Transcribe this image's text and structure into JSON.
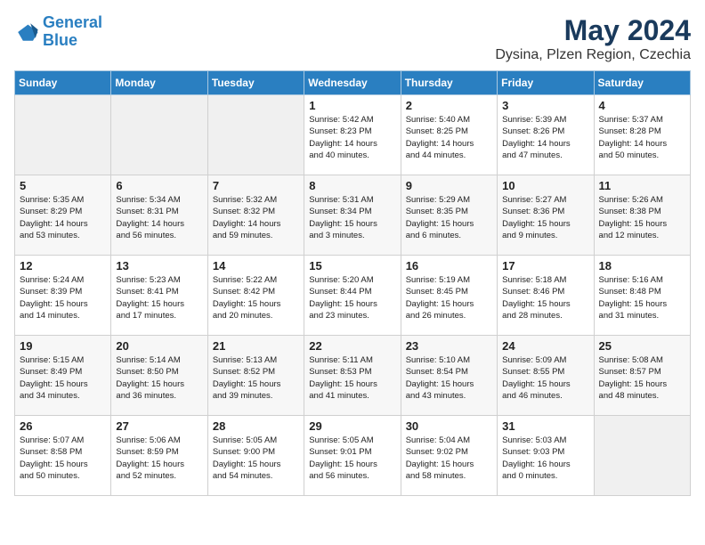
{
  "header": {
    "logo_line1": "General",
    "logo_line2": "Blue",
    "title": "May 2024",
    "subtitle": "Dysina, Plzen Region, Czechia"
  },
  "days_of_week": [
    "Sunday",
    "Monday",
    "Tuesday",
    "Wednesday",
    "Thursday",
    "Friday",
    "Saturday"
  ],
  "weeks": [
    [
      {
        "day": "",
        "info": ""
      },
      {
        "day": "",
        "info": ""
      },
      {
        "day": "",
        "info": ""
      },
      {
        "day": "1",
        "info": "Sunrise: 5:42 AM\nSunset: 8:23 PM\nDaylight: 14 hours\nand 40 minutes."
      },
      {
        "day": "2",
        "info": "Sunrise: 5:40 AM\nSunset: 8:25 PM\nDaylight: 14 hours\nand 44 minutes."
      },
      {
        "day": "3",
        "info": "Sunrise: 5:39 AM\nSunset: 8:26 PM\nDaylight: 14 hours\nand 47 minutes."
      },
      {
        "day": "4",
        "info": "Sunrise: 5:37 AM\nSunset: 8:28 PM\nDaylight: 14 hours\nand 50 minutes."
      }
    ],
    [
      {
        "day": "5",
        "info": "Sunrise: 5:35 AM\nSunset: 8:29 PM\nDaylight: 14 hours\nand 53 minutes."
      },
      {
        "day": "6",
        "info": "Sunrise: 5:34 AM\nSunset: 8:31 PM\nDaylight: 14 hours\nand 56 minutes."
      },
      {
        "day": "7",
        "info": "Sunrise: 5:32 AM\nSunset: 8:32 PM\nDaylight: 14 hours\nand 59 minutes."
      },
      {
        "day": "8",
        "info": "Sunrise: 5:31 AM\nSunset: 8:34 PM\nDaylight: 15 hours\nand 3 minutes."
      },
      {
        "day": "9",
        "info": "Sunrise: 5:29 AM\nSunset: 8:35 PM\nDaylight: 15 hours\nand 6 minutes."
      },
      {
        "day": "10",
        "info": "Sunrise: 5:27 AM\nSunset: 8:36 PM\nDaylight: 15 hours\nand 9 minutes."
      },
      {
        "day": "11",
        "info": "Sunrise: 5:26 AM\nSunset: 8:38 PM\nDaylight: 15 hours\nand 12 minutes."
      }
    ],
    [
      {
        "day": "12",
        "info": "Sunrise: 5:24 AM\nSunset: 8:39 PM\nDaylight: 15 hours\nand 14 minutes."
      },
      {
        "day": "13",
        "info": "Sunrise: 5:23 AM\nSunset: 8:41 PM\nDaylight: 15 hours\nand 17 minutes."
      },
      {
        "day": "14",
        "info": "Sunrise: 5:22 AM\nSunset: 8:42 PM\nDaylight: 15 hours\nand 20 minutes."
      },
      {
        "day": "15",
        "info": "Sunrise: 5:20 AM\nSunset: 8:44 PM\nDaylight: 15 hours\nand 23 minutes."
      },
      {
        "day": "16",
        "info": "Sunrise: 5:19 AM\nSunset: 8:45 PM\nDaylight: 15 hours\nand 26 minutes."
      },
      {
        "day": "17",
        "info": "Sunrise: 5:18 AM\nSunset: 8:46 PM\nDaylight: 15 hours\nand 28 minutes."
      },
      {
        "day": "18",
        "info": "Sunrise: 5:16 AM\nSunset: 8:48 PM\nDaylight: 15 hours\nand 31 minutes."
      }
    ],
    [
      {
        "day": "19",
        "info": "Sunrise: 5:15 AM\nSunset: 8:49 PM\nDaylight: 15 hours\nand 34 minutes."
      },
      {
        "day": "20",
        "info": "Sunrise: 5:14 AM\nSunset: 8:50 PM\nDaylight: 15 hours\nand 36 minutes."
      },
      {
        "day": "21",
        "info": "Sunrise: 5:13 AM\nSunset: 8:52 PM\nDaylight: 15 hours\nand 39 minutes."
      },
      {
        "day": "22",
        "info": "Sunrise: 5:11 AM\nSunset: 8:53 PM\nDaylight: 15 hours\nand 41 minutes."
      },
      {
        "day": "23",
        "info": "Sunrise: 5:10 AM\nSunset: 8:54 PM\nDaylight: 15 hours\nand 43 minutes."
      },
      {
        "day": "24",
        "info": "Sunrise: 5:09 AM\nSunset: 8:55 PM\nDaylight: 15 hours\nand 46 minutes."
      },
      {
        "day": "25",
        "info": "Sunrise: 5:08 AM\nSunset: 8:57 PM\nDaylight: 15 hours\nand 48 minutes."
      }
    ],
    [
      {
        "day": "26",
        "info": "Sunrise: 5:07 AM\nSunset: 8:58 PM\nDaylight: 15 hours\nand 50 minutes."
      },
      {
        "day": "27",
        "info": "Sunrise: 5:06 AM\nSunset: 8:59 PM\nDaylight: 15 hours\nand 52 minutes."
      },
      {
        "day": "28",
        "info": "Sunrise: 5:05 AM\nSunset: 9:00 PM\nDaylight: 15 hours\nand 54 minutes."
      },
      {
        "day": "29",
        "info": "Sunrise: 5:05 AM\nSunset: 9:01 PM\nDaylight: 15 hours\nand 56 minutes."
      },
      {
        "day": "30",
        "info": "Sunrise: 5:04 AM\nSunset: 9:02 PM\nDaylight: 15 hours\nand 58 minutes."
      },
      {
        "day": "31",
        "info": "Sunrise: 5:03 AM\nSunset: 9:03 PM\nDaylight: 16 hours\nand 0 minutes."
      },
      {
        "day": "",
        "info": ""
      }
    ]
  ]
}
